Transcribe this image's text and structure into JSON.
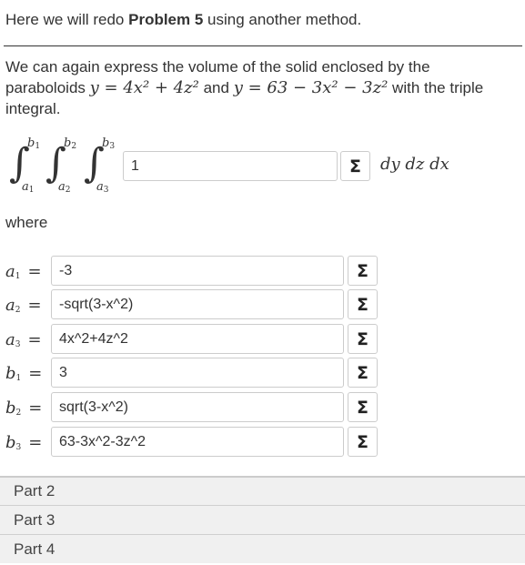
{
  "intro": {
    "prefix": "Here we will redo ",
    "bold": "Problem 5",
    "suffix": " using another method."
  },
  "paragraph": {
    "line1": "We can again express the volume of the solid enclosed by the",
    "paraboloids_word": "paraboloids",
    "eq1": "y = 4x² + 4z²",
    "and_word": "and",
    "eq2": "y = 63 − 3x² − 3z²",
    "tail": "with the triple",
    "line3": "integral."
  },
  "integral": {
    "bounds": [
      {
        "upper": "b",
        "upper_sub": "1",
        "lower": "a",
        "lower_sub": "1"
      },
      {
        "upper": "b",
        "upper_sub": "2",
        "lower": "a",
        "lower_sub": "2"
      },
      {
        "upper": "b",
        "upper_sub": "3",
        "lower": "a",
        "lower_sub": "3"
      }
    ],
    "integrand_value": "1",
    "differentials": "dy dz dx"
  },
  "where_label": "where",
  "variables": [
    {
      "sym": "a",
      "sub": "1",
      "value": "-3"
    },
    {
      "sym": "a",
      "sub": "2",
      "value": "-sqrt(3-x^2)"
    },
    {
      "sym": "a",
      "sub": "3",
      "value": "4x^2+4z^2"
    },
    {
      "sym": "b",
      "sub": "1",
      "value": "3"
    },
    {
      "sym": "b",
      "sub": "2",
      "value": "sqrt(3-x^2)"
    },
    {
      "sym": "b",
      "sub": "3",
      "value": "63-3x^2-3z^2"
    }
  ],
  "sigma_icon": "Σ",
  "parts": [
    "Part 2",
    "Part 3",
    "Part 4"
  ]
}
